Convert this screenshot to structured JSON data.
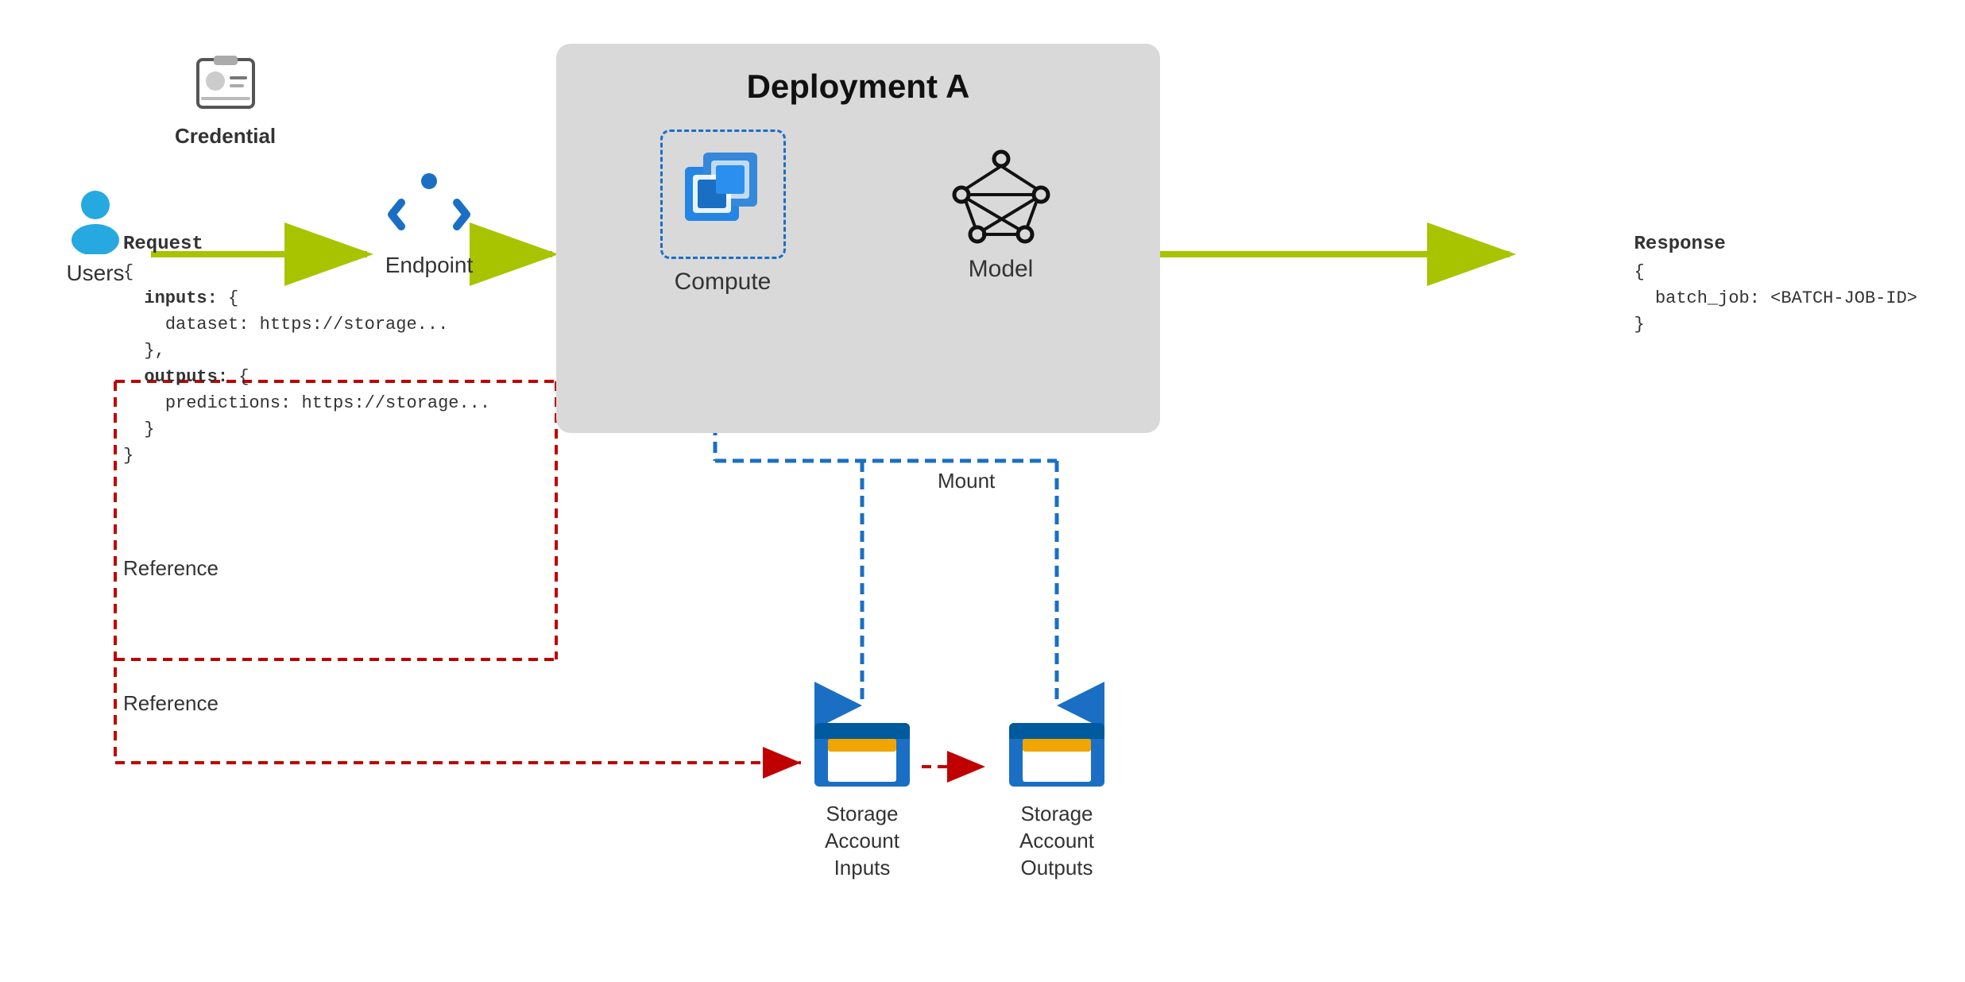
{
  "users": {
    "label": "Users"
  },
  "credential": {
    "label": "Credential"
  },
  "endpoint": {
    "label": "Endpoint"
  },
  "deployment": {
    "title": "Deployment A",
    "compute_label": "Compute",
    "model_label": "Model"
  },
  "request": {
    "label": "Request",
    "line1": "{",
    "line2": "inputs: {",
    "line3": "dataset: https://storage...",
    "line4": "},",
    "line5": "outputs: {",
    "line6": "predictions: https://storage...",
    "line7": "}",
    "line8": "}"
  },
  "response": {
    "label": "Response",
    "line1": "{",
    "line2": "batch_job: <BATCH-JOB-ID>",
    "line3": "}"
  },
  "storage_inputs": {
    "label": "Storage Account\nInputs"
  },
  "storage_outputs": {
    "label": "Storage Account\nOutputs"
  },
  "mount_label": "Mount",
  "reference_label_1": "Reference",
  "reference_label_2": "Reference",
  "colors": {
    "lime": "#a8c400",
    "blue_arrow": "#1a6fc4",
    "red_dashed": "#c00000"
  }
}
